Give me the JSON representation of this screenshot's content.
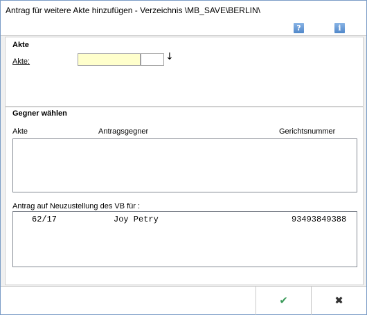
{
  "window": {
    "title": "Antrag für weitere Akte hinzufügen - Verzeichnis \\MB_SAVE\\BERLIN\\"
  },
  "toolbar": {
    "help_icon": "?",
    "info_icon": "i"
  },
  "akte": {
    "section_title": "Akte",
    "label": "Akte:",
    "value": "",
    "suffix_value": "",
    "arrow_icon": "↓"
  },
  "gegner": {
    "section_title": "Gegner wählen",
    "columns": {
      "akte": "Akte",
      "antragsgegner": "Antragsgegner",
      "gerichtsnummer": "Gerichtsnummer"
    },
    "rows": []
  },
  "vb": {
    "label": "Antrag auf Neuzustellung des VB für :",
    "rows": [
      {
        "akte": "62/17",
        "name": "Joy Petry",
        "nummer": "93493849388"
      }
    ]
  },
  "footer": {
    "ok_icon": "✔",
    "cancel_icon": "✖"
  }
}
